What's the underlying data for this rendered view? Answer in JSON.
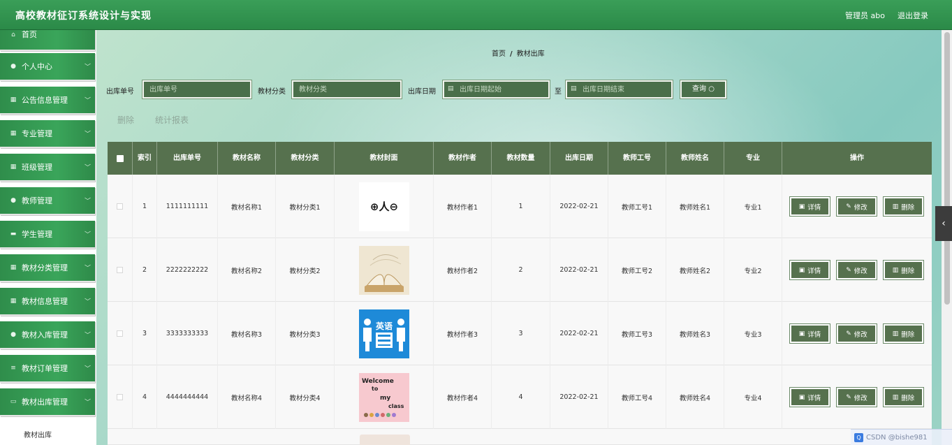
{
  "header": {
    "title": "高校教材征订系统设计与实现",
    "user_label": "管理员 abo",
    "logout_label": "退出登录"
  },
  "sidebar": {
    "items": [
      {
        "label": "首页",
        "icon": "home-icon"
      },
      {
        "label": "个人中心",
        "icon": "user-icon"
      },
      {
        "label": "公告信息管理",
        "icon": "grid-icon"
      },
      {
        "label": "专业管理",
        "icon": "grid-icon"
      },
      {
        "label": "班级管理",
        "icon": "grid-icon"
      },
      {
        "label": "教师管理",
        "icon": "user-icon"
      },
      {
        "label": "学生管理",
        "icon": "comment-icon"
      },
      {
        "label": "教材分类管理",
        "icon": "grid-icon"
      },
      {
        "label": "教材信息管理",
        "icon": "grid-icon"
      },
      {
        "label": "教材入库管理",
        "icon": "user-icon"
      },
      {
        "label": "教材订单管理",
        "icon": "list-icon"
      },
      {
        "label": "教材出库管理",
        "icon": "monitor-icon"
      }
    ],
    "active_sub": "教材出库"
  },
  "breadcrumb": {
    "home": "首页",
    "separator": "/",
    "current": "教材出库"
  },
  "search": {
    "out_no_label": "出库单号",
    "out_no_placeholder": "出库单号",
    "category_label": "教材分类",
    "category_placeholder": "教材分类",
    "date_label": "出库日期",
    "date_start_placeholder": "出库日期起始",
    "to_label": "至",
    "date_end_placeholder": "出库日期结束",
    "query_label": "查询"
  },
  "toolbar": {
    "delete_label": "删除",
    "report_label": "统计报表"
  },
  "table": {
    "columns": [
      "索引",
      "出库单号",
      "教材名称",
      "教材分类",
      "教材封面",
      "教材作者",
      "教材数量",
      "出库日期",
      "教师工号",
      "教师姓名",
      "专业",
      "操作"
    ],
    "index_header_line1": "索",
    "index_header_line2": "引",
    "rows": [
      {
        "index": "1",
        "out_no": "1111111111",
        "name": "教材名称1",
        "category": "教材分类1",
        "cover_text": "⊕人⊖",
        "author": "教材作者1",
        "qty": "1",
        "date": "2022-02-21",
        "teacher_no": "教师工号1",
        "teacher_name": "教师姓名1",
        "major": "专业1"
      },
      {
        "index": "2",
        "out_no": "2222222222",
        "name": "教材名称2",
        "category": "教材分类2",
        "cover_text": "",
        "author": "教材作者2",
        "qty": "2",
        "date": "2022-02-21",
        "teacher_no": "教师工号2",
        "teacher_name": "教师姓名2",
        "major": "专业2"
      },
      {
        "index": "3",
        "out_no": "3333333333",
        "name": "教材名称3",
        "category": "教材分类3",
        "cover_text": "英语",
        "author": "教材作者3",
        "qty": "3",
        "date": "2022-02-21",
        "teacher_no": "教师工号3",
        "teacher_name": "教师姓名3",
        "major": "专业3"
      },
      {
        "index": "4",
        "out_no": "4444444444",
        "name": "教材名称4",
        "category": "教材分类4",
        "cover_text": "Welcome to my class",
        "author": "教材作者4",
        "qty": "4",
        "date": "2022-02-21",
        "teacher_no": "教师工号4",
        "teacher_name": "教师姓名4",
        "major": "专业4"
      }
    ],
    "actions": {
      "detail": "详情",
      "edit": "修改",
      "delete": "删除"
    }
  },
  "watermark": "CSDN @bishe981",
  "colors": {
    "header_green": "#2b8a48",
    "table_header": "#56714e",
    "button": "#56714e"
  }
}
